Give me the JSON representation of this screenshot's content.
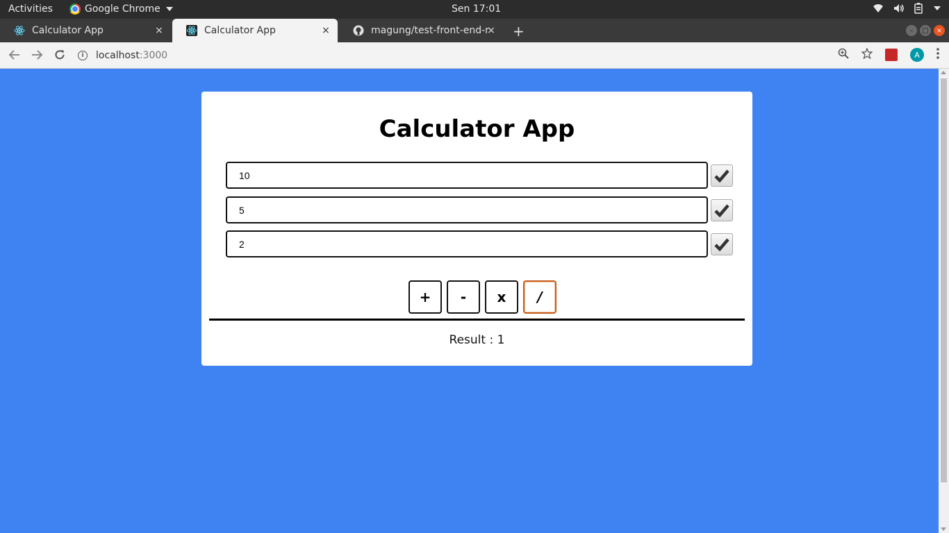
{
  "system_bar": {
    "activities": "Activities",
    "app_name": "Google Chrome",
    "clock": "Sen 17:01"
  },
  "browser": {
    "tabs": [
      {
        "title": "Calculator App",
        "icon": "react-icon",
        "active": false
      },
      {
        "title": "Calculator App",
        "icon": "react-icon",
        "active": true
      },
      {
        "title": "magung/test-front-end-r",
        "icon": "github-icon",
        "active": false
      }
    ],
    "close_glyph": "×",
    "new_tab_glyph": "+",
    "url_host": "localhost",
    "url_port": ":3000",
    "avatar_letter": "A"
  },
  "app": {
    "title": "Calculator App",
    "inputs": [
      {
        "value": "10",
        "checked": true
      },
      {
        "value": "5",
        "checked": true
      },
      {
        "value": "2",
        "checked": true
      }
    ],
    "operators": [
      "+",
      "-",
      "x",
      "/"
    ],
    "focused_operator": "/",
    "result_label": "Result : 1"
  },
  "colors": {
    "page_background": "#3f83f2",
    "card_background": "#ffffff",
    "focus_border": "#c85a1a"
  }
}
